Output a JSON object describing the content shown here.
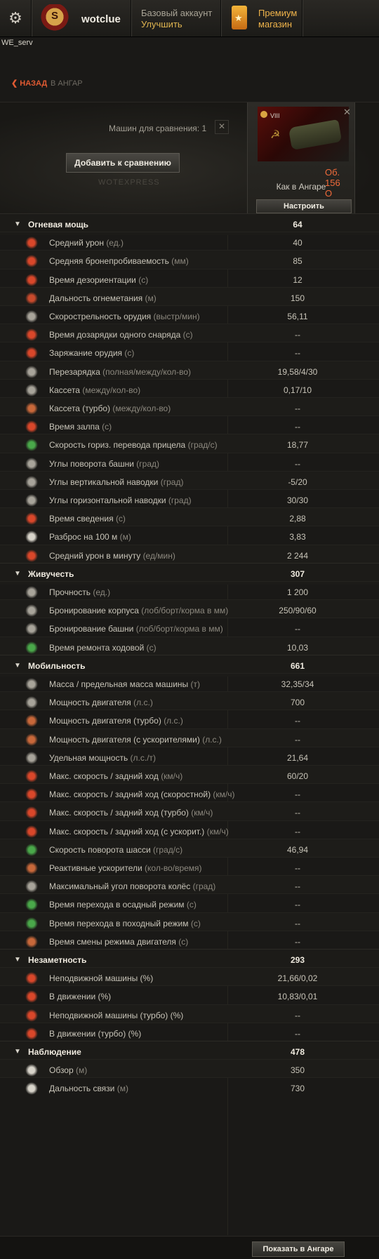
{
  "topbar": {
    "nickname": "wotclue",
    "account_type": "Базовый аккаунт",
    "upgrade": "Улучшить",
    "shop_line1": "Премиум",
    "shop_line2": "магазин",
    "server": "WE_serv"
  },
  "nav": {
    "back": "НАЗАД",
    "crumb": "В АНГАР"
  },
  "compare": {
    "label": "Машин для сравнения: 1",
    "add_button": "Добавить к сравнению",
    "watermark": "WOTEXPRESS"
  },
  "tank": {
    "tier": "VIII",
    "name": "Об. 156 О",
    "status": "Как в Ангаре",
    "setup_button": "Настроить"
  },
  "sections": [
    {
      "title": "Огневая мощь",
      "value": "64",
      "rows": [
        {
          "label": "Средний урон",
          "unit": "(ед.)",
          "value": "40",
          "icon_color": "#d9472a"
        },
        {
          "label": "Средняя бронепробиваемость",
          "unit": "(мм)",
          "value": "85",
          "icon_color": "#d9472a"
        },
        {
          "label": "Время дезориентации",
          "unit": "(с)",
          "value": "12",
          "icon_color": "#d9472a"
        },
        {
          "label": "Дальность огнеметания",
          "unit": "(м)",
          "value": "150",
          "icon_color": "#c84a2c"
        },
        {
          "label": "Скорострельность орудия",
          "unit": "(выстр/мин)",
          "value": "56,11",
          "icon_color": "#a8a49a"
        },
        {
          "label": "Время дозарядки одного снаряда",
          "unit": "(с)",
          "value": "--",
          "icon_color": "#d9472a"
        },
        {
          "label": "Заряжание орудия",
          "unit": "(с)",
          "value": "--",
          "icon_color": "#d9472a"
        },
        {
          "label": "Перезарядка",
          "unit": "(полная/между/кол-во)",
          "value": "19,58/4/30",
          "icon_color": "#a8a49a"
        },
        {
          "label": "Кассета",
          "unit": "(между/кол-во)",
          "value": "0,17/10",
          "icon_color": "#a8a49a"
        },
        {
          "label": "Кассета (турбо)",
          "unit": "(между/кол-во)",
          "value": "--",
          "icon_color": "#c8683a"
        },
        {
          "label": "Время залпа",
          "unit": "(с)",
          "value": "--",
          "icon_color": "#d9472a"
        },
        {
          "label": "Скорость гориз. перевода прицела",
          "unit": "(град/с)",
          "value": "18,77",
          "icon_color": "#4aa84a"
        },
        {
          "label": "Углы поворота башни",
          "unit": "(град)",
          "value": "--",
          "icon_color": "#a8a49a"
        },
        {
          "label": "Углы вертикальной наводки",
          "unit": "(град)",
          "value": "-5/20",
          "icon_color": "#a8a49a"
        },
        {
          "label": "Углы горизонтальной наводки",
          "unit": "(град)",
          "value": "30/30",
          "icon_color": "#a8a49a"
        },
        {
          "label": "Время сведения",
          "unit": "(с)",
          "value": "2,88",
          "icon_color": "#d9472a"
        },
        {
          "label": "Разброс на 100 м",
          "unit": "(м)",
          "value": "3,83",
          "icon_color": "#d8d4ca"
        },
        {
          "label": "Средний урон в минуту",
          "unit": "(ед/мин)",
          "value": "2 244",
          "icon_color": "#d9472a"
        }
      ]
    },
    {
      "title": "Живучесть",
      "value": "307",
      "rows": [
        {
          "label": "Прочность",
          "unit": "(ед.)",
          "value": "1 200",
          "icon_color": "#a8a49a"
        },
        {
          "label": "Бронирование корпуса",
          "unit": "(лоб/борт/корма в мм)",
          "value": "250/90/60",
          "icon_color": "#a8a49a"
        },
        {
          "label": "Бронирование башни",
          "unit": "(лоб/борт/корма в мм)",
          "value": "--",
          "icon_color": "#a8a49a"
        },
        {
          "label": "Время ремонта ходовой",
          "unit": "(с)",
          "value": "10,03",
          "icon_color": "#4aa84a"
        }
      ]
    },
    {
      "title": "Мобильность",
      "value": "661",
      "rows": [
        {
          "label": "Масса / предельная масса машины",
          "unit": "(т)",
          "value": "32,35/34",
          "icon_color": "#a8a49a"
        },
        {
          "label": "Мощность двигателя",
          "unit": "(л.с.)",
          "value": "700",
          "icon_color": "#a8a49a"
        },
        {
          "label": "Мощность двигателя (турбо)",
          "unit": "(л.с.)",
          "value": "--",
          "icon_color": "#c8683a"
        },
        {
          "label": "Мощность двигателя (с ускорителями)",
          "unit": "(л.с.)",
          "value": "--",
          "icon_color": "#c8683a"
        },
        {
          "label": "Удельная мощность",
          "unit": "(л.с./т)",
          "value": "21,64",
          "icon_color": "#a8a49a"
        },
        {
          "label": "Макс. скорость / задний ход",
          "unit": "(км/ч)",
          "value": "60/20",
          "icon_color": "#d9472a"
        },
        {
          "label": "Макс. скорость / задний ход (скоростной)",
          "unit": "(км/ч)",
          "value": "--",
          "icon_color": "#d9472a"
        },
        {
          "label": "Макс. скорость / задний ход (турбо)",
          "unit": "(км/ч)",
          "value": "--",
          "icon_color": "#d9472a"
        },
        {
          "label": "Макс. скорость / задний ход (с ускорит.)",
          "unit": "(км/ч)",
          "value": "--",
          "icon_color": "#d9472a"
        },
        {
          "label": "Скорость поворота шасси",
          "unit": "(град/с)",
          "value": "46,94",
          "icon_color": "#4aa84a"
        },
        {
          "label": "Реактивные ускорители",
          "unit": "(кол-во/время)",
          "value": "--",
          "icon_color": "#c8683a"
        },
        {
          "label": "Максимальный угол поворота колёс",
          "unit": "(град)",
          "value": "--",
          "icon_color": "#a8a49a"
        },
        {
          "label": "Время перехода в осадный режим ",
          "unit": "(с)",
          "value": "--",
          "icon_color": "#4aa84a"
        },
        {
          "label": "Время перехода в походный режим ",
          "unit": "(с)",
          "value": "--",
          "icon_color": "#4aa84a"
        },
        {
          "label": "Время смены режима двигателя",
          "unit": "(с)",
          "value": "--",
          "icon_color": "#c8683a"
        }
      ]
    },
    {
      "title": "Незаметность",
      "value": "293",
      "rows": [
        {
          "label": "Неподвижной машины (%)",
          "unit": "",
          "value": "21,66/0,02",
          "icon_color": "#d9472a"
        },
        {
          "label": "В движении (%)",
          "unit": "",
          "value": "10,83/0,01",
          "icon_color": "#d9472a"
        },
        {
          "label": "Неподвижной машины (турбо) (%)",
          "unit": "",
          "value": "--",
          "icon_color": "#d9472a"
        },
        {
          "label": "В движении (турбо) (%)",
          "unit": "",
          "value": "--",
          "icon_color": "#d9472a"
        }
      ]
    },
    {
      "title": "Наблюдение",
      "value": "478",
      "rows": [
        {
          "label": "Обзор",
          "unit": "(м)",
          "value": "350",
          "icon_color": "#d8d4ca"
        },
        {
          "label": "Дальность связи",
          "unit": "(м)",
          "value": "730",
          "icon_color": "#d8d4ca"
        }
      ]
    }
  ],
  "footer": {
    "show_button": "Показать в Ангаре"
  }
}
